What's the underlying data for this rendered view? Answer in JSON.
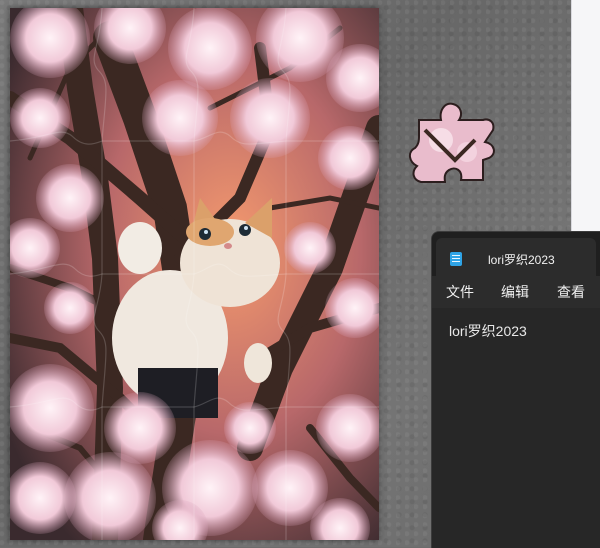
{
  "notepad": {
    "tab_title": "lori罗织2023",
    "menu": [
      {
        "label": "文件"
      },
      {
        "label": "编辑"
      },
      {
        "label": "查看"
      }
    ],
    "content": "lori罗织2023"
  },
  "puzzle": {
    "image_subject": "cat-in-cherry-blossom-tree",
    "colors": {
      "blossom": "#f0c8d8",
      "blossom_light": "#fbe8ef",
      "branch": "#3d2a24",
      "cat": "#efe6dc",
      "cat_orange": "#d9a36a",
      "glow": "#f2956a",
      "board": "#6c6c6c"
    }
  }
}
